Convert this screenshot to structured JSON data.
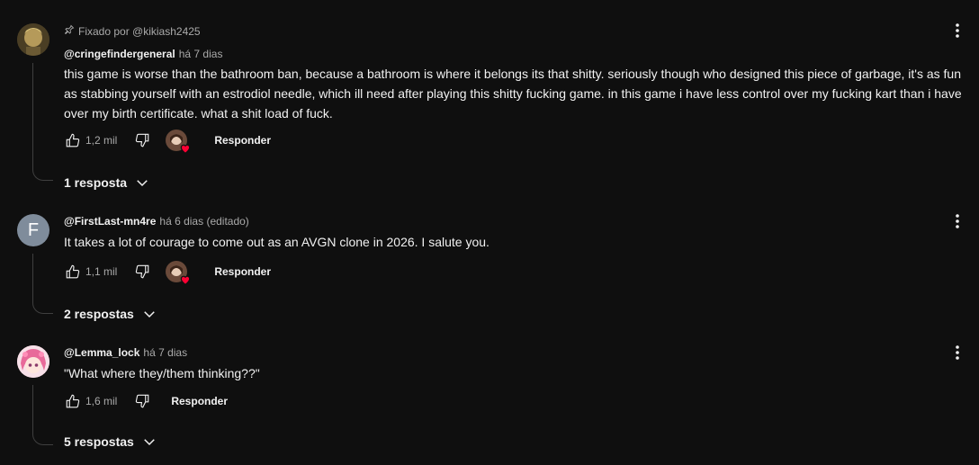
{
  "comments": [
    {
      "pinned_text": "Fixado por @kikiash2425",
      "author": "@cringefindergeneral",
      "meta": "há 7 dias",
      "lines": [
        "this game is worse than the bathroom ban, because a bathroom is where it belongs its that shitty. seriously though who designed this piece of garbage, it's as fun",
        "as stabbing yourself with an estrodiol needle, which ill need after playing this shitty fucking game. in this game i have less control over my fucking kart than i have",
        "over my birth certificate. what a shit load of fuck."
      ],
      "likes": "1,2 mil",
      "reply_label": "Responder",
      "replies_label": "1 resposta"
    },
    {
      "avatar_letter": "F",
      "author": "@FirstLast-mn4re",
      "meta": "há 6 dias (editado)",
      "lines": [
        "It takes a lot of courage to come out as an AVGN clone in 2026. I salute you."
      ],
      "likes": "1,1 mil",
      "reply_label": "Responder",
      "replies_label": "2 respostas"
    },
    {
      "author": "@Lemma_lock",
      "meta": "há 7 dias",
      "lines": [
        "\"What where they/them thinking??\""
      ],
      "likes": "1,6 mil",
      "reply_label": "Responder",
      "replies_label": "5 respostas"
    }
  ],
  "icons": [
    "pin-icon",
    "thumbs-up-icon",
    "thumbs-down-icon",
    "heart-icon",
    "chevron-down-icon",
    "more-vert-icon"
  ],
  "colors": {
    "background": "#0f0f0f",
    "text": "#f1f1f1",
    "secondary": "#aaaaaa",
    "heart": "#ff0033",
    "avatar_f": "#7f8c9b"
  }
}
